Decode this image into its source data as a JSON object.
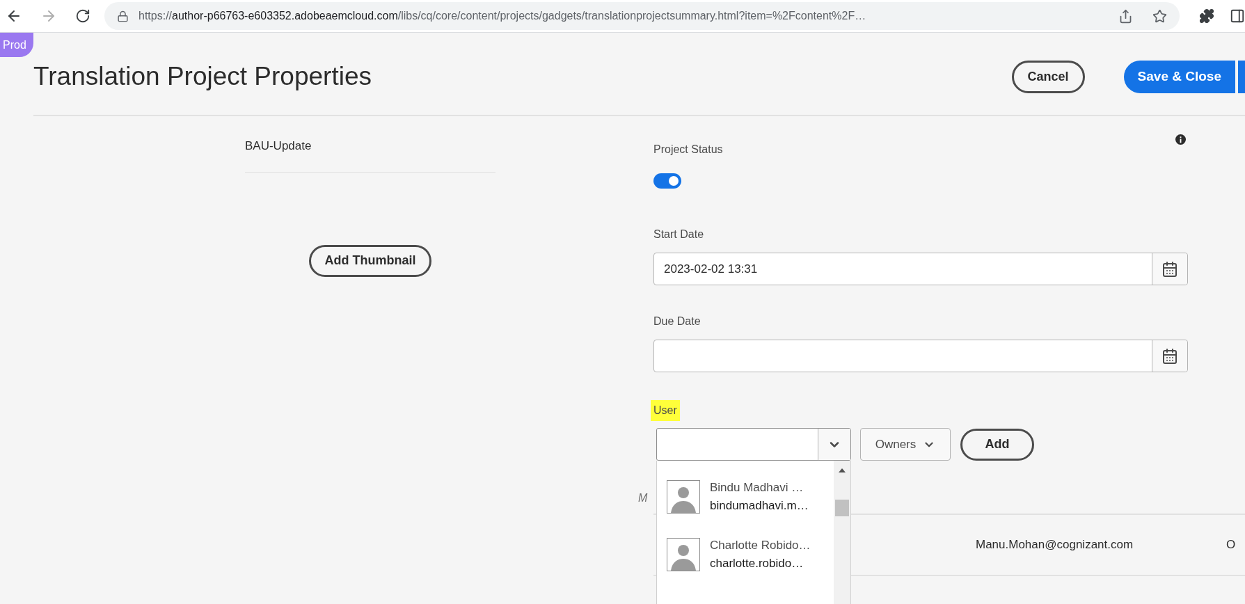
{
  "browser": {
    "back": {
      "disabled": false
    },
    "forward": {
      "disabled": true
    },
    "url": {
      "scheme": "https://",
      "host": "author-p66763-e603352.adobeaemcloud.com",
      "path": "/libs/cq/core/content/projects/gadgets/translationprojectsummary.html?item=%2Fcontent%2F…"
    }
  },
  "environment_badge": "Prod",
  "title": "Translation Project Properties",
  "actions": [
    {
      "label": "Cancel",
      "kind": "secondary"
    },
    {
      "label": "Save & Close",
      "kind": "primary"
    }
  ],
  "project_name": "BAU-Update",
  "thumbnail_button": "Add Thumbnail",
  "project_status": {
    "label": "Project Status",
    "on": true
  },
  "start_date": {
    "label": "Start Date",
    "value": "2023-02-02 13:31"
  },
  "due_date": {
    "label": "Due Date"
  },
  "user": {
    "label": "User",
    "highlighted": true,
    "role": "Owners",
    "add_button": "Add",
    "suggestions": [
      {
        "name": "Bindu Madhavi …",
        "email": "bindumadhavi.m…"
      },
      {
        "name": "Charlotte Robido…",
        "email": "charlotte.robido…"
      }
    ]
  },
  "members": {
    "column_1": "M",
    "rows": [
      {
        "email": "Manu.Mohan@cognizant.com",
        "column_3": "O"
      }
    ]
  }
}
